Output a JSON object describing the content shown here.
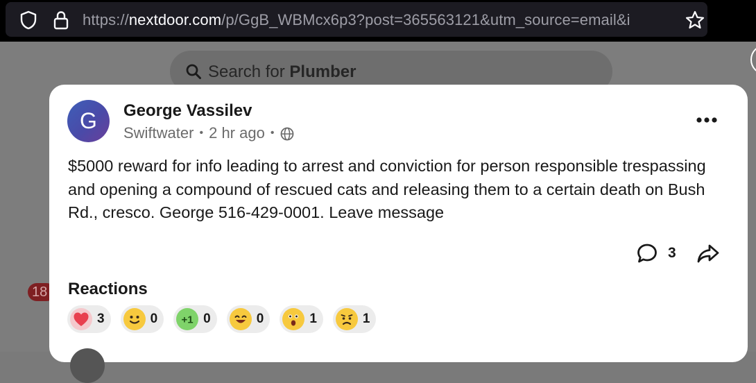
{
  "browser": {
    "url_prefix": "https://",
    "url_domain": "nextdoor.com",
    "url_rest": "/p/GgB_WBMcx6p3?post=365563121&utm_source=email&i"
  },
  "search": {
    "prefix": "Search for ",
    "term": "Plumber"
  },
  "sidebar": {
    "badge_count": "18"
  },
  "post": {
    "avatar_initial": "G",
    "author": "George Vassilev",
    "neighborhood": "Swiftwater",
    "time_ago": "2 hr ago",
    "body": "$5000 reward for info leading to arrest and conviction for person responsible trespassing and opening a compound of rescued cats and releasing them to a certain death on Bush Rd., cresco. George 516-429-0001. Leave message",
    "comment_count": "3"
  },
  "reactions": {
    "title": "Reactions",
    "items": [
      {
        "icon": "heart-icon",
        "count": "3"
      },
      {
        "icon": "smile-icon",
        "count": "0"
      },
      {
        "icon": "plus-one-icon",
        "count": "0"
      },
      {
        "icon": "laugh-icon",
        "count": "0"
      },
      {
        "icon": "surprised-icon",
        "count": "1"
      },
      {
        "icon": "sad-icon",
        "count": "1"
      }
    ]
  },
  "colors": {
    "accent_blue": "#3e5fb8",
    "badge_red": "#7e1f22",
    "card_bg": "#ffffff"
  }
}
